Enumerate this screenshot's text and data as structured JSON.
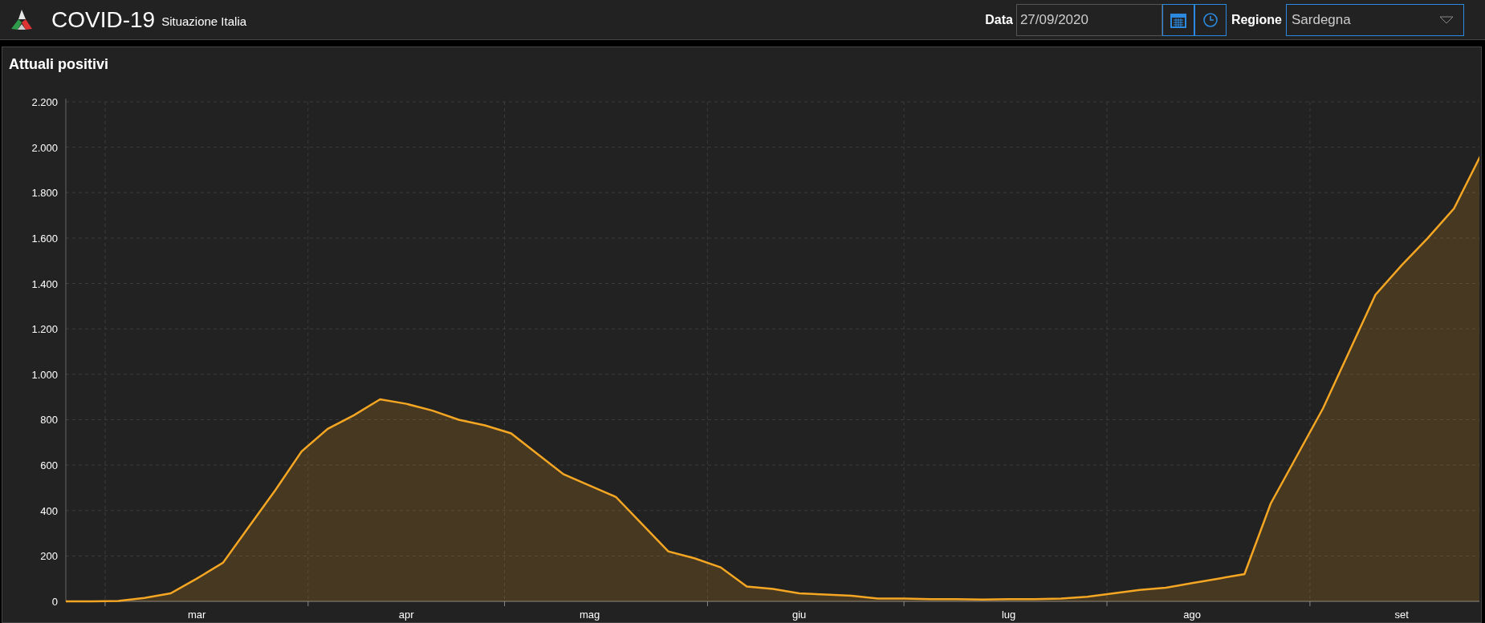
{
  "header": {
    "title": "COVID-19",
    "subtitle": "Situazione Italia",
    "date_label": "Data",
    "date_value": "27/09/2020",
    "region_label": "Regione",
    "region_value": "Sardegna"
  },
  "panel": {
    "title": "Attuali positivi",
    "chart_data": {
      "type": "area",
      "categories": [
        null,
        null,
        null,
        null,
        null,
        "mar",
        null,
        null,
        null,
        null,
        null,
        null,
        null,
        "apr",
        null,
        null,
        null,
        null,
        null,
        null,
        "mag",
        null,
        null,
        null,
        null,
        null,
        null,
        null,
        "giu",
        null,
        null,
        null,
        null,
        null,
        null,
        null,
        "lug",
        null,
        null,
        null,
        null,
        null,
        null,
        "ago",
        null,
        null,
        null,
        null,
        null,
        null,
        null,
        "set",
        null,
        null,
        null
      ],
      "series": [
        {
          "color": "#f5a623",
          "values": [
            0,
            0,
            2,
            15,
            35,
            100,
            170,
            330,
            490,
            660,
            760,
            820,
            890,
            870,
            840,
            800,
            775,
            740,
            650,
            560,
            510,
            460,
            340,
            220,
            190,
            150,
            65,
            55,
            35,
            30,
            25,
            12,
            12,
            10,
            10,
            8,
            10,
            10,
            12,
            20,
            35,
            50,
            60,
            80,
            100,
            120,
            430,
            640,
            850,
            1100,
            1350,
            1480,
            1600,
            1730,
            1960
          ]
        }
      ],
      "ylim": [
        0,
        2200
      ],
      "grid": true,
      "yticks": [
        {
          "value": 0,
          "label": "0"
        },
        {
          "value": 200,
          "label": "200"
        },
        {
          "value": 400,
          "label": "400"
        },
        {
          "value": 600,
          "label": "600"
        },
        {
          "value": 800,
          "label": "800"
        },
        {
          "value": 1000,
          "label": "1.000"
        },
        {
          "value": 1200,
          "label": "1.200"
        },
        {
          "value": 1400,
          "label": "1.400"
        },
        {
          "value": 1600,
          "label": "1.600"
        },
        {
          "value": 1800,
          "label": "1.800"
        },
        {
          "value": 2000,
          "label": "2.000"
        },
        {
          "value": 2200,
          "label": "2.200"
        }
      ]
    }
  }
}
